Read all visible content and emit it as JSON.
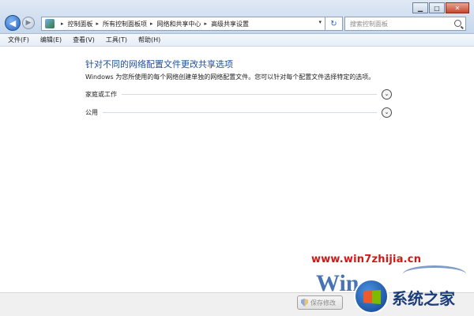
{
  "window": {
    "controls": {
      "minimize": "▁",
      "maximize": "□",
      "close": "✕"
    }
  },
  "address_bar": {
    "breadcrumbs": [
      "控制面板",
      "所有控制面板项",
      "网络和共享中心",
      "高级共享设置"
    ],
    "dropdown": "▾",
    "refresh": "↻"
  },
  "search": {
    "placeholder": "搜索控制面板"
  },
  "nav": {
    "back": "◀",
    "forward": "▶",
    "history": "▾"
  },
  "menu": [
    "文件(F)",
    "编辑(E)",
    "查看(V)",
    "工具(T)",
    "帮助(H)"
  ],
  "content": {
    "title": "针对不同的网络配置文件更改共享选项",
    "description": "Windows 为您所使用的每个网络创建单独的网络配置文件。您可以针对每个配置文件选择特定的选项。",
    "sections": [
      {
        "label": "家庭或工作",
        "expander": "⌄"
      },
      {
        "label": "公用",
        "expander": "⌄"
      }
    ]
  },
  "footer": {
    "save_label": "保存修改"
  },
  "watermark": {
    "url": "www.win7zhijia.cn",
    "win": "Win",
    "brand": "系统之家"
  }
}
